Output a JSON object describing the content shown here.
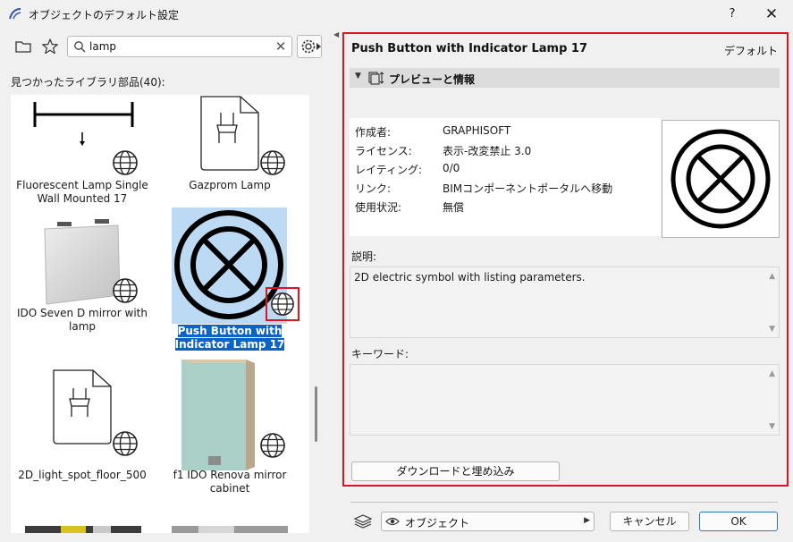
{
  "window": {
    "title": "オブジェクトのデフォルト設定",
    "help_label": "?",
    "close_label": "✕"
  },
  "library": {
    "search_value": "lamp",
    "found_label": "見つかったライブラリ部品(40):",
    "items": [
      {
        "label": "Fluorescent Lamp Single Wall Mounted 17",
        "icon": "globe-icon"
      },
      {
        "label": "Gazprom Lamp",
        "icon": "globe-icon"
      },
      {
        "label": "IDO Seven D mirror with lamp",
        "icon": "globe-icon"
      },
      {
        "label": "Push Button with Indicator Lamp 17",
        "icon": "globe-icon",
        "selected": true
      },
      {
        "label": "2D_light_spot_floor_500",
        "icon": "globe-icon"
      },
      {
        "label": "f1 IDO Renova mirror cabinet",
        "icon": "globe-icon"
      }
    ]
  },
  "details": {
    "object_title": "Push Button with Indicator Lamp 17",
    "default_label": "デフォルト",
    "section_label": "プレビューと情報",
    "info": [
      {
        "key": "作成者:",
        "value": "GRAPHISOFT"
      },
      {
        "key": "ライセンス:",
        "value": "表示-改変禁止 3.0"
      },
      {
        "key": "レイティング:",
        "value": "0/0"
      },
      {
        "key": "リンク:",
        "value": "BIMコンポーネントポータルへ移動"
      },
      {
        "key": "使用状況:",
        "value": "無償"
      }
    ],
    "description_label": "説明:",
    "description_text": "2D electric symbol with listing parameters.",
    "keywords_label": "キーワード:",
    "download_label": "ダウンロードと埋め込み"
  },
  "footer": {
    "layer_label": "オブジェクト",
    "cancel_label": "キャンセル",
    "ok_label": "OK"
  },
  "colors": {
    "accent": "#0a64c8",
    "highlight": "#e0141e",
    "selection_bg": "#bcdaf3"
  }
}
